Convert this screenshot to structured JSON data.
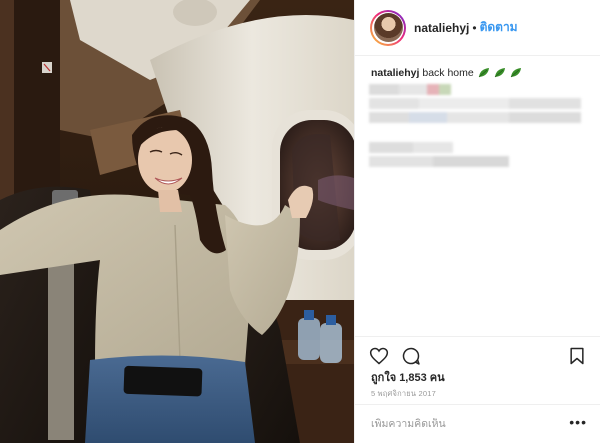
{
  "post": {
    "username": "nataliehyj",
    "separator": "•",
    "follow_label": "ติดตาม",
    "caption": {
      "username": "nataliehyj",
      "text": "back home"
    },
    "likes_text": "ถูกใจ 1,853 คน",
    "date": "5 พฤศจิกายน 2017",
    "comment_placeholder": "เพิ่มความคิดเห็น",
    "more_label": "•••"
  },
  "icons": {
    "caption_emoji": "herb-leaf-icon",
    "like": "heart-icon",
    "comment": "comment-bubble-icon",
    "save": "bookmark-icon",
    "more": "ellipsis-icon"
  },
  "colors": {
    "link": "#3897f0",
    "text": "#262626",
    "muted": "#999999",
    "border": "#efefef",
    "leaf": "#3a8f2a"
  }
}
